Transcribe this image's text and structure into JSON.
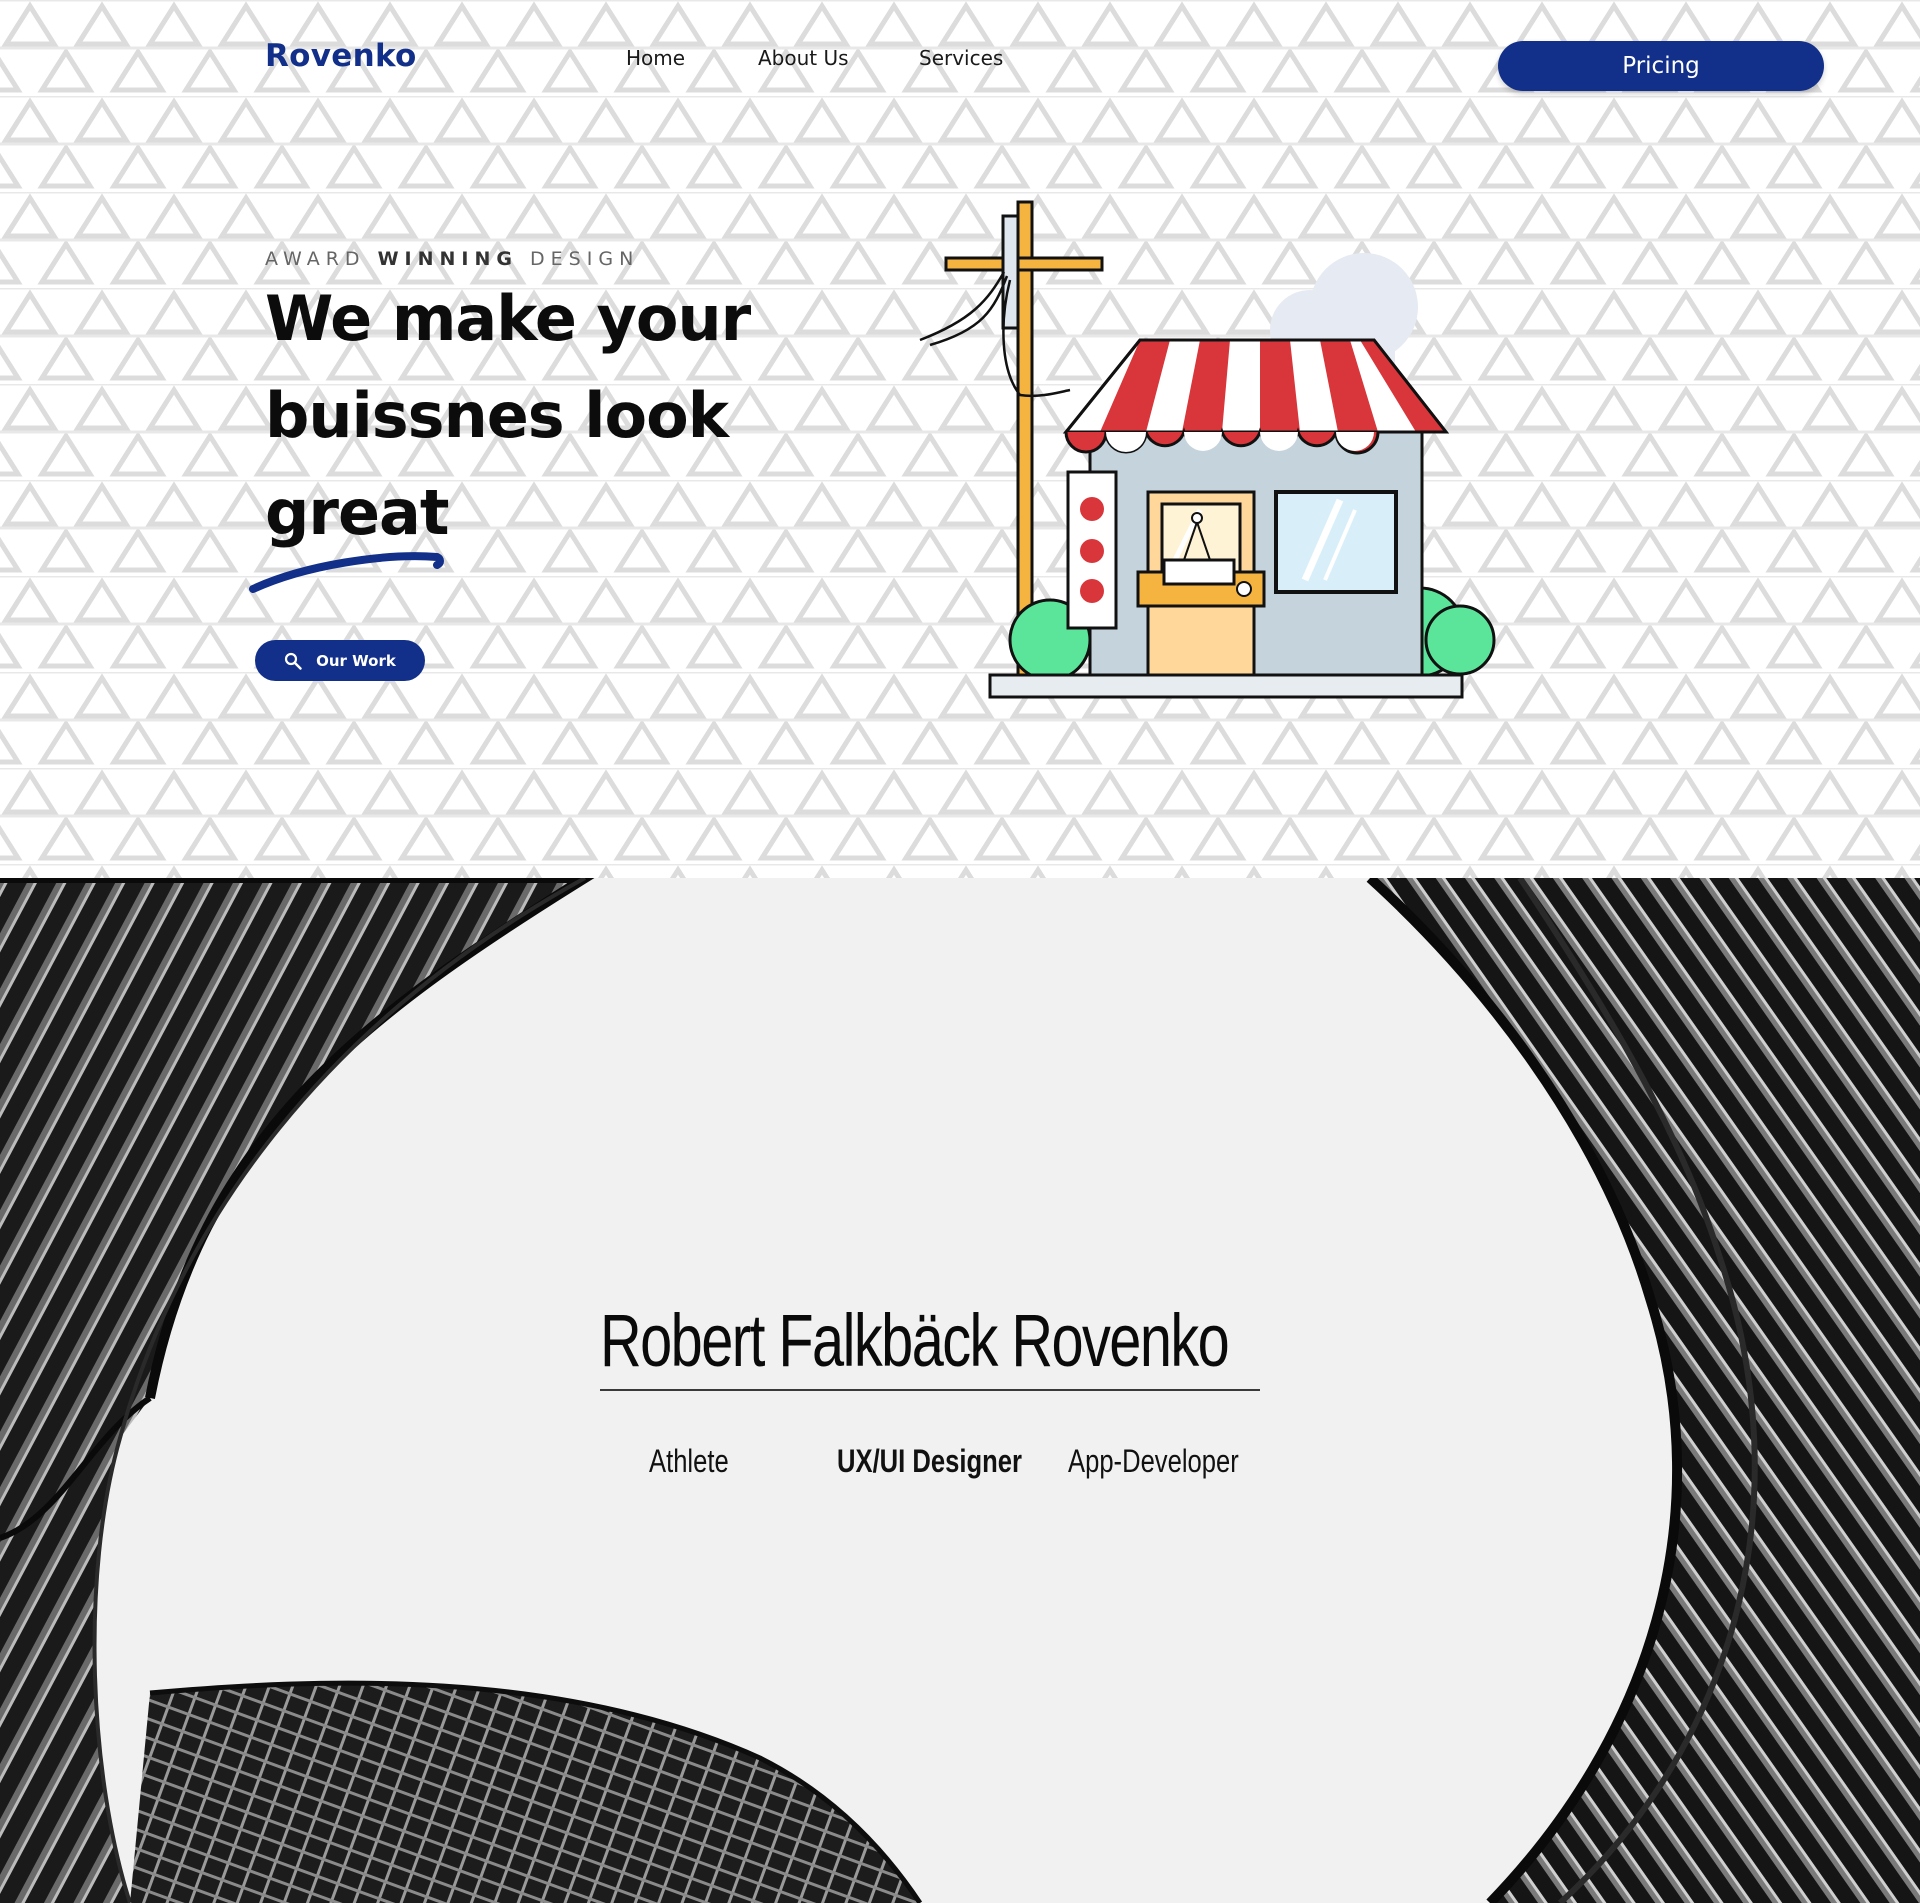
{
  "header": {
    "logo": "Rovenko",
    "nav": [
      "Home",
      "About Us",
      "Services"
    ],
    "cta": "Pricing"
  },
  "hero": {
    "eyebrow_1": "AWARD",
    "eyebrow_2": "WINNING",
    "eyebrow_3": "DESIGN",
    "headline": [
      "We make your",
      "buissnes look",
      "great"
    ],
    "button": "Our Work"
  },
  "profile": {
    "name": "Robert Falkbäck Rovenko",
    "roles": [
      "Athlete",
      "UX/UI Designer",
      "App-Developer"
    ]
  },
  "colors": {
    "brand": "#12308a",
    "awning_red": "#d8363a",
    "bush_green": "#5be59a",
    "pole_orange": "#f5b340"
  },
  "icons": {
    "button_icon": "search-icon"
  }
}
